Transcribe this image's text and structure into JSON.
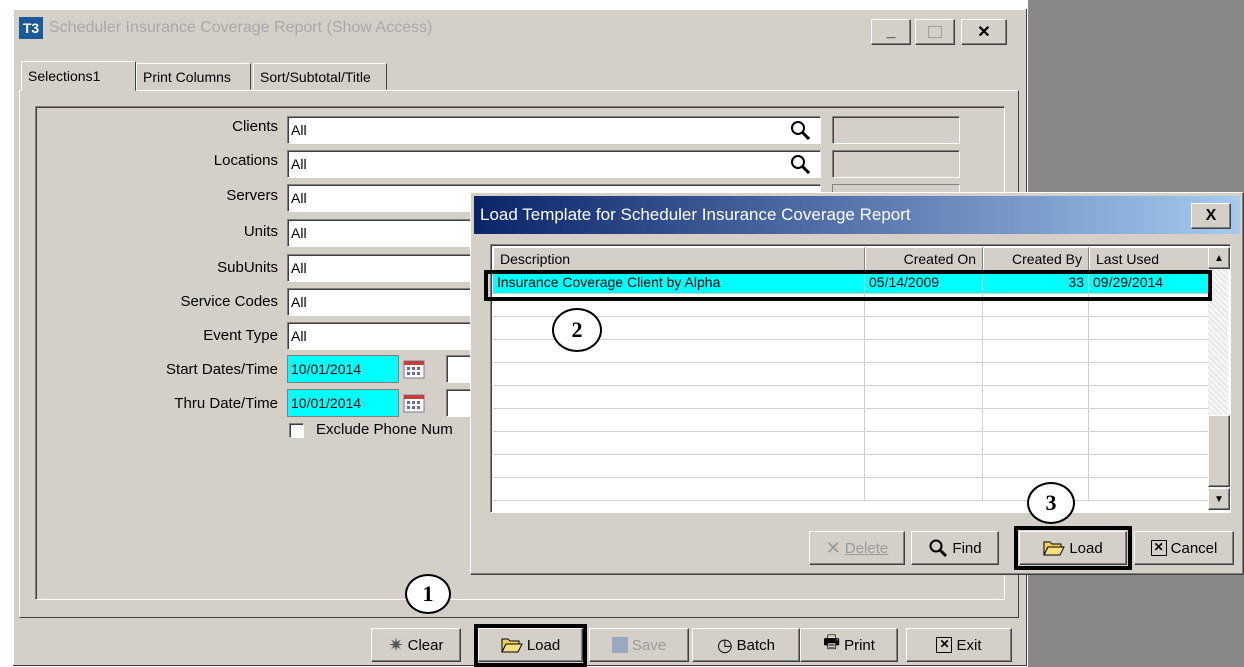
{
  "main_window": {
    "title": "Scheduler Insurance Coverage Report (Show Access)",
    "app_icon": "T3",
    "tabs": [
      {
        "label": "Selections1"
      },
      {
        "label": "Print Columns"
      },
      {
        "label": "Sort/Subtotal/Title"
      }
    ],
    "fields": [
      {
        "label": "Clients",
        "value": "All"
      },
      {
        "label": "Locations",
        "value": "All"
      },
      {
        "label": "Servers",
        "value": "All"
      },
      {
        "label": "Units",
        "value": "All"
      },
      {
        "label": "SubUnits",
        "value": "All"
      },
      {
        "label": "Service Codes",
        "value": "All"
      },
      {
        "label": "Event Type",
        "value": "All"
      }
    ],
    "start_date_label": "Start Dates/Time",
    "start_date_value": "10/01/2014",
    "thru_date_label": "Thru Date/Time",
    "thru_date_value": "10/01/2014",
    "exclude_label": "Exclude Phone Num",
    "buttons": {
      "clear": "Clear",
      "load": "Load",
      "save": "Save",
      "batch": "Batch",
      "print": "Print",
      "exit": "Exit"
    }
  },
  "dialog": {
    "title": "Load Template for Scheduler Insurance Coverage Report",
    "close": "X",
    "columns": [
      "Description",
      "Created On",
      "Created By",
      "Last Used"
    ],
    "rows": [
      {
        "description": "Insurance Coverage Client by Alpha",
        "created_on": "05/14/2009",
        "created_by": "33",
        "last_used": "09/29/2014"
      }
    ],
    "buttons": {
      "delete": "Delete",
      "find": "Find",
      "load": "Load",
      "cancel": "Cancel"
    }
  },
  "callouts": [
    "1",
    "2",
    "3"
  ],
  "colors": {
    "selection": "#00ffff",
    "dialog_title": "#0a246a",
    "window_face": "#d4d0c8"
  }
}
